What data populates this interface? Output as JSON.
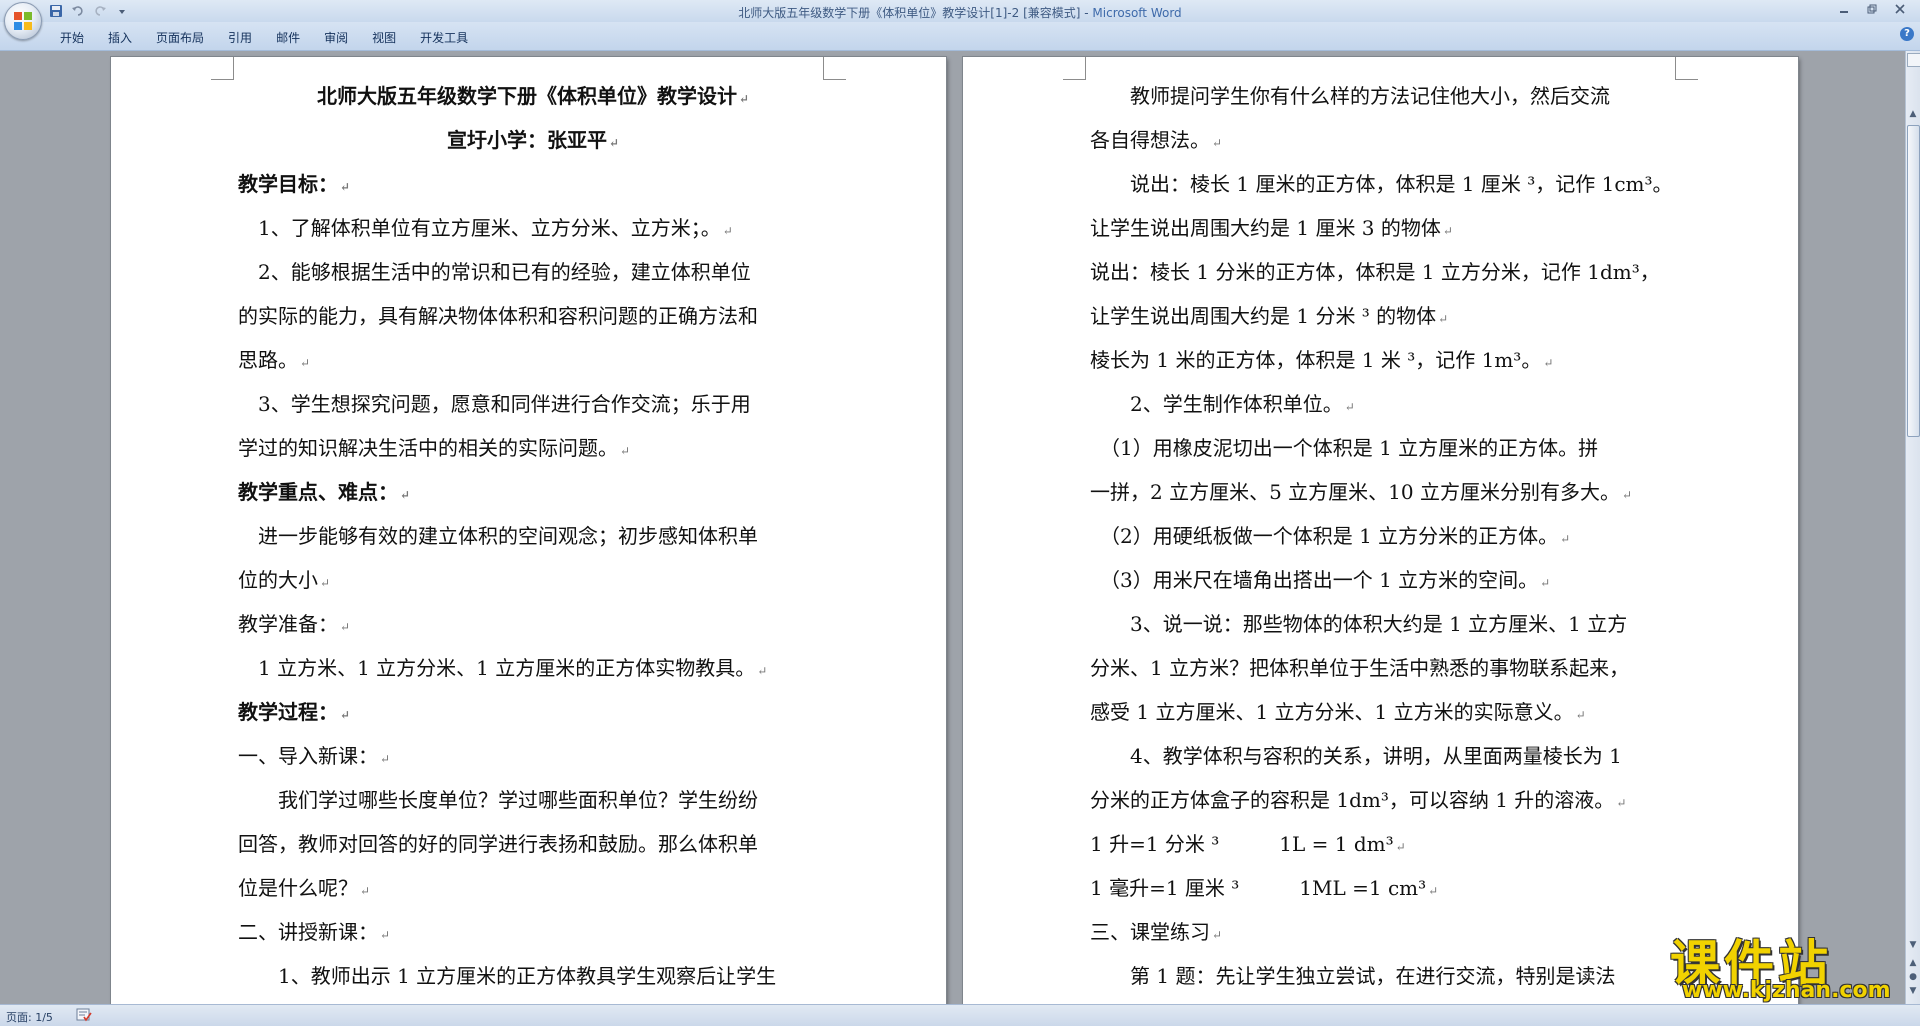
{
  "window": {
    "title_doc": "北师大版五年级数学下册《体积单位》教学设计[1]-2 [兼容模式] - ",
    "title_app": "Microsoft Word",
    "help": "?"
  },
  "ribbon": {
    "tabs": [
      "开始",
      "插入",
      "页面布局",
      "引用",
      "邮件",
      "审阅",
      "视图",
      "开发工具"
    ]
  },
  "page1": {
    "lines": [
      "北师大版五年级数学下册《体积单位》教学设计",
      "宣圩小学：张亚平",
      "教学目标：",
      "　1、了解体积单位有立方厘米、立方分米、立方米；。",
      "　2、能够根据生活中的常识和已有的经验，建立体积单位",
      "的实际的能力，具有解决物体体积和容积问题的正确方法和",
      "思路。",
      "　3、学生想探究问题，愿意和同伴进行合作交流；乐于用",
      "学过的知识解决生活中的相关的实际问题。",
      "教学重点、难点：",
      "　进一步能够有效的建立体积的空间观念；初步感知体积单",
      "位的大小",
      "教学准备：",
      "　1 立方米、1 立方分米、1 立方厘米的正方体实物教具。",
      "教学过程：",
      "一、导入新课：",
      "　　我们学过哪些长度单位？学过哪些面积单位？学生纷纷",
      "回答，教师对回答的好的同学进行表扬和鼓励。那么体积单",
      "位是什么呢？",
      "二、讲授新课：",
      "　　1、教师出示 1 立方厘米的正方体教具学生观察后让学生"
    ]
  },
  "page2": {
    "lines": [
      "　　教师提问学生你有什么样的方法记住他大小，然后交流",
      "各自得想法。",
      "　　说出：棱长 1 厘米的正方体，体积是 1 厘米 ³，记作 1cm³。",
      "让学生说出周围大约是 1 厘米 3 的物体",
      "说出：棱长 1 分米的正方体，体积是 1 立方分米，记作 1dm³，",
      "让学生说出周围大约是 1 分米 ³ 的物体",
      "棱长为 1 米的正方体，体积是 1 米 ³，记作 1m³。",
      "　　2、学生制作体积单位。",
      "　（1）用橡皮泥切出一个体积是  1  立方厘米的正方体。拼",
      "一拼，2 立方厘米、5 立方厘米、10 立方厘米分别有多大。",
      "　（2）用硬纸板做一个体积是 1 立方分米的正方体。",
      "　（3）用米尺在墙角出搭出一个 1 立方米的空间。",
      "　　3、说一说：那些物体的体积大约是 1 立方厘米、1 立方",
      "分米、1 立方米？把体积单位于生活中熟悉的事物联系起来，",
      "感受 1 立方厘米、1 立方分米、1 立方米的实际意义。",
      "　　4、教学体积与容积的关系，讲明，从里面两量棱长为 1",
      "分米的正方体盒子的容积是 1dm³，可以容纳 1 升的溶液。",
      "1 升=1 分米 ³　　　1L = 1 dm³",
      "1 毫升=1 厘米 ³　　　1ML =1 cm³",
      "三、课堂练习",
      "　　第  1  题：先让学生独立尝试，在进行交流，特别是读法"
    ]
  },
  "status": {
    "page_count": "页面: 1/5"
  },
  "watermark": {
    "title": "课件站",
    "url": "www.kjzhan.com"
  }
}
